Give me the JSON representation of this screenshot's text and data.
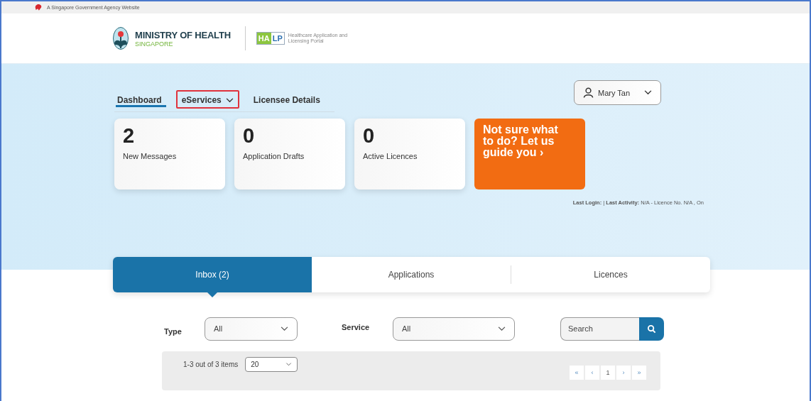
{
  "top_bar": {
    "text": "A Singapore Government Agency Website"
  },
  "header": {
    "ministry": {
      "name": "MINISTRY OF HEALTH",
      "country": "SINGAPORE"
    },
    "portal": {
      "logo_left": "HA",
      "logo_right": "LP",
      "name": "Healthcare Application and Licensing Portal"
    }
  },
  "nav": [
    {
      "label": "Dashboard",
      "selected": true,
      "highlighted": false,
      "dropdown": false
    },
    {
      "label": "eServices",
      "selected": false,
      "highlighted": true,
      "dropdown": true
    },
    {
      "label": "Licensee Details",
      "selected": false,
      "highlighted": false,
      "dropdown": false
    }
  ],
  "user_menu": {
    "name": "Mary Tan"
  },
  "stats": [
    {
      "count": "2",
      "label": "New Messages"
    },
    {
      "count": "0",
      "label": "Application Drafts"
    },
    {
      "count": "0",
      "label": "Active Licences"
    }
  ],
  "guide_card": {
    "text": "Not sure what to do? Let us guide you ›"
  },
  "last_login": "**Last Login:** | **Last Activity:** N/A - Licence No. N/A , On",
  "tabs": [
    {
      "label": "Inbox (2)",
      "selected": true
    },
    {
      "label": "Applications",
      "selected": false
    },
    {
      "label": "Licences",
      "selected": false
    }
  ],
  "filters": {
    "type": {
      "label": "Type",
      "value": "All"
    },
    "service": {
      "label": "Service",
      "value": "All"
    },
    "search": {
      "placeholder": "Search"
    }
  },
  "pagination": {
    "summary": "1-3 out of 3 items",
    "page_size": "20",
    "buttons": [
      "«",
      "‹",
      "1",
      "›",
      "»"
    ]
  }
}
